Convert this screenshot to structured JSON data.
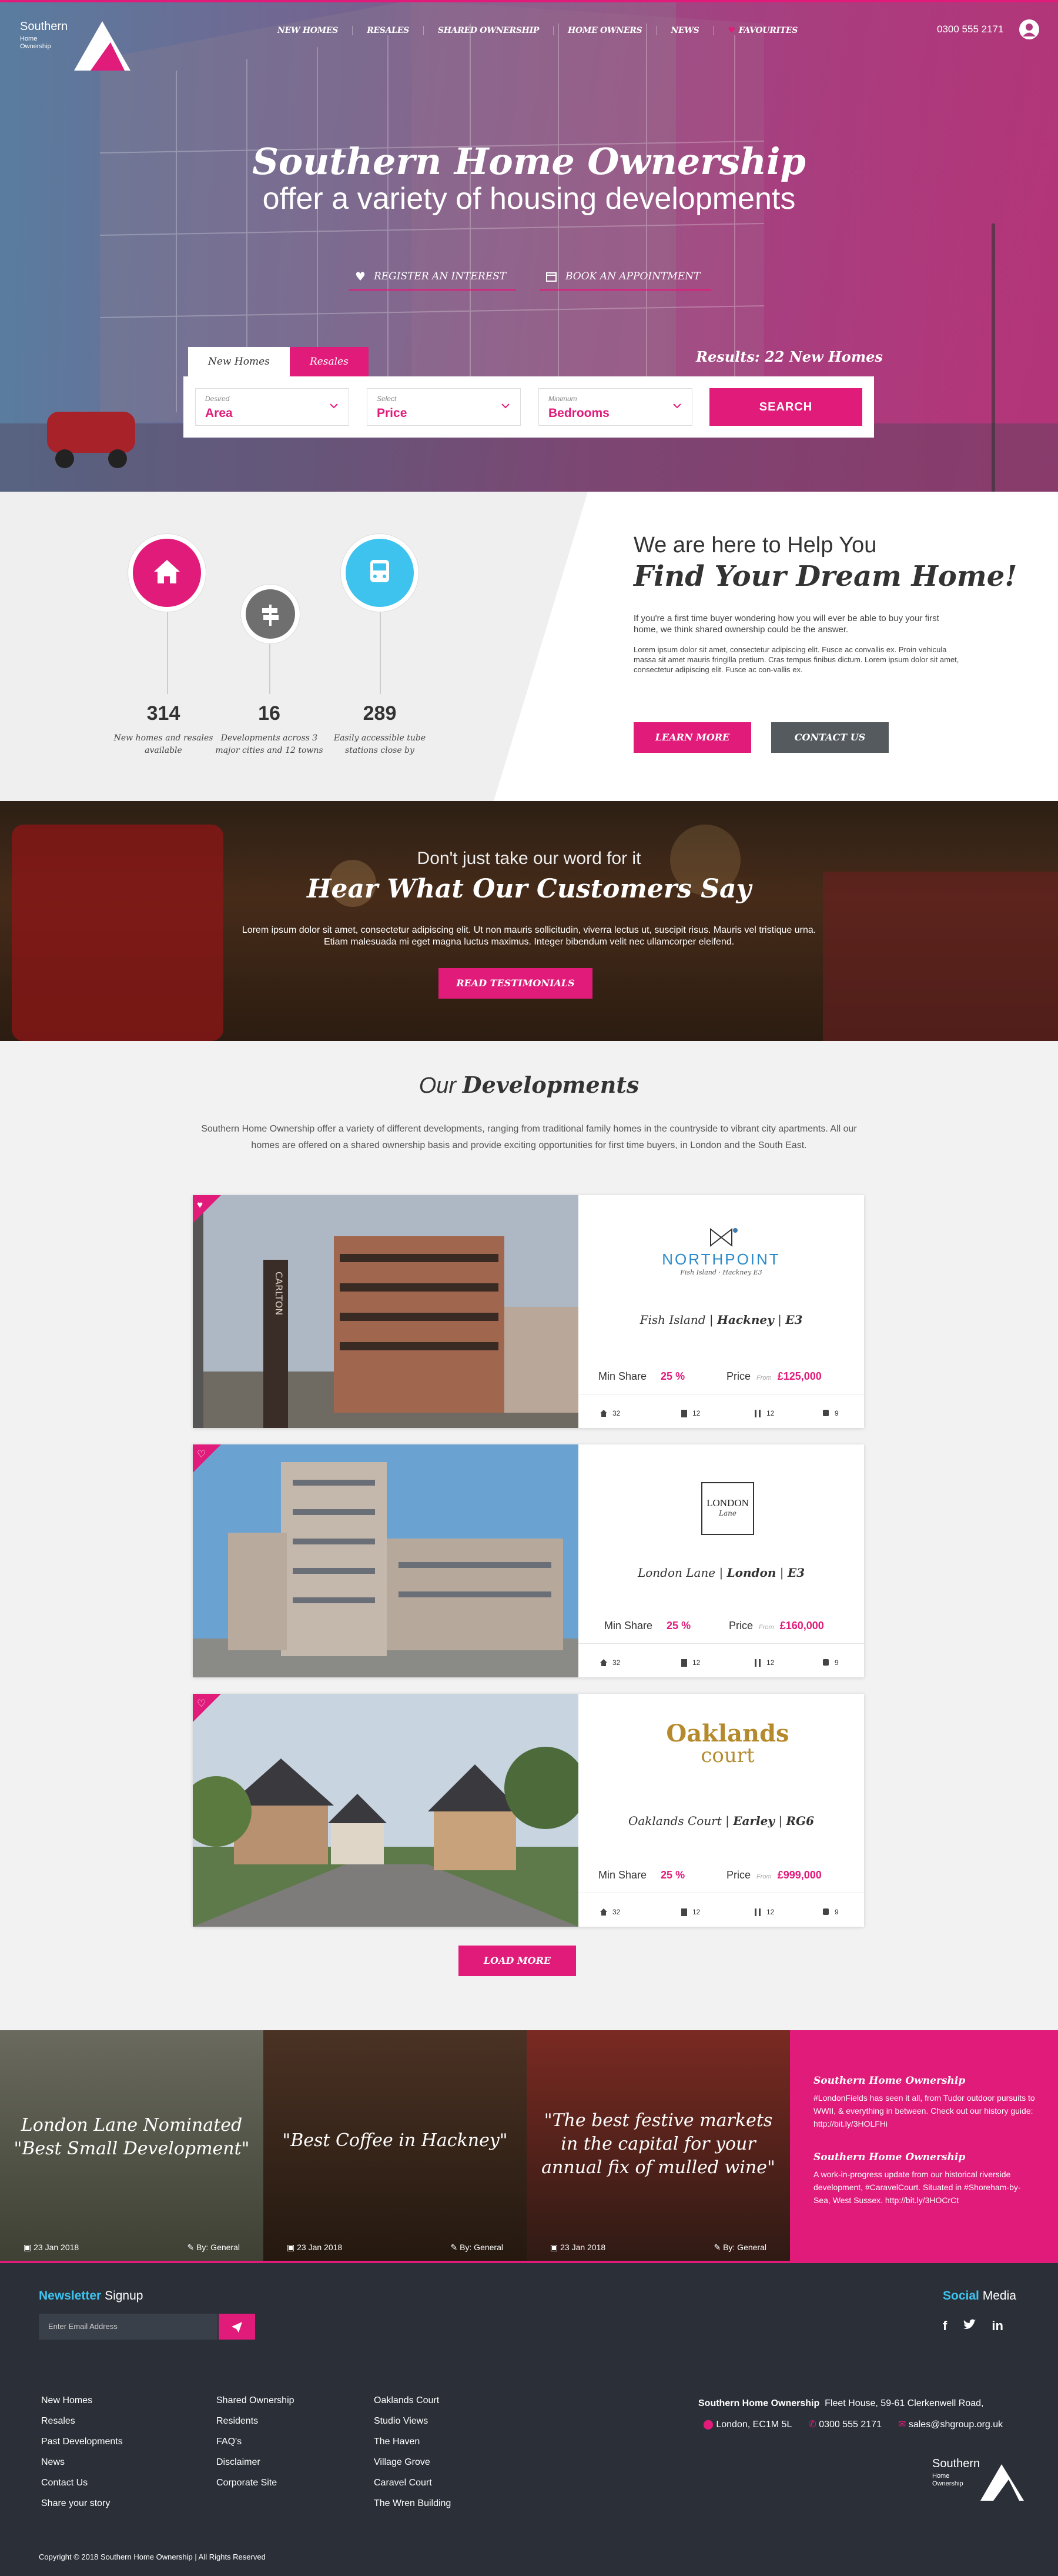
{
  "header": {
    "nav": [
      "NEW HOMES",
      "RESALES",
      "SHARED OWNERSHIP",
      "HOME OWNERS",
      "NEWS",
      "FAVOURITES"
    ],
    "phone": "0300 555 2171",
    "logo_word": "Southern",
    "logo_sub": "Home Ownership"
  },
  "hero": {
    "title": "Southern Home Ownership",
    "subtitle": "offer a variety of housing developments",
    "btn_register": "REGISTER AN INTEREST",
    "btn_appointment": "BOOK AN APPOINTMENT",
    "tab_new": "New Homes",
    "tab_resales": "Resales",
    "results": "Results: 22 New Homes",
    "filters": [
      {
        "label": "Desired",
        "value": "Area"
      },
      {
        "label": "Select",
        "value": "Price"
      },
      {
        "label": "Minimum",
        "value": "Bedrooms"
      }
    ],
    "search": "SEARCH"
  },
  "help": {
    "stats": [
      {
        "num": "314",
        "desc": "New homes and resales available"
      },
      {
        "num": "16",
        "desc": "Developments across 3 major cities and 12 towns"
      },
      {
        "num": "289",
        "desc": "Easily accessible tube stations close by"
      }
    ],
    "heading1": "We are here to Help You",
    "heading2": "Find Your Dream Home!",
    "para1": "If you're a first time buyer wondering how you will ever be able to buy your first home, we think shared ownership could be the answer.",
    "para2": "Lorem ipsum dolor sit amet, consectetur adipiscing elit. Fusce ac convallis ex. Proin vehicula massa sit amet mauris fringilla pretium. Cras tempus finibus dictum. Lorem ipsum dolor sit amet, consectetur adipiscing elit. Fusce ac con-vallis ex.",
    "learn": "LEARN MORE",
    "contact": "CONTACT US"
  },
  "testimonials": {
    "line1": "Don't just take our word for it",
    "line2": "Hear What Our Customers Say",
    "text": "Lorem ipsum dolor sit amet, consectetur adipiscing elit. Ut non mauris sollicitudin, viverra lectus ut, suscipit risus. Mauris vel tristique urna. Etiam malesuada mi eget magna luctus maximus. Integer bibendum velit nec ullamcorper eleifend.",
    "button": "READ TESTIMONIALS"
  },
  "developments": {
    "title_a": "Our",
    "title_b": "Developments",
    "intro": "Southern Home Ownership offer a variety of different developments, ranging from traditional family homes in the countryside to vibrant city apartments. All our homes are offered on a shared ownership basis and provide exciting opportunities for first time buyers, in London and the South East.",
    "min_share_label": "Min Share",
    "price_label": "Price",
    "from": "From",
    "load_more": "LOAD MORE",
    "items": [
      {
        "logo": "NORTHPOINT",
        "logo_sub": "Fish Island · Hackney E3",
        "loc_a": "Fish Island",
        "loc_b": "Hackney",
        "loc_c": "E3",
        "share": "25 %",
        "price": "£125,000",
        "icons": [
          "32",
          "12",
          "12",
          "9"
        ],
        "photo_text": "CARLTON"
      },
      {
        "logo": "LONDON",
        "logo_sub": "Lane",
        "loc_a": "London Lane",
        "loc_b": "London",
        "loc_c": "E3",
        "share": "25 %",
        "price": "£160,000",
        "icons": [
          "32",
          "12",
          "12",
          "9"
        ]
      },
      {
        "logo": "Oaklands",
        "logo_sub": "court",
        "loc_a": "Oaklands Court",
        "loc_b": "Earley",
        "loc_c": "RG6",
        "share": "25 %",
        "price": "£999,000",
        "icons": [
          "32",
          "12",
          "12",
          "9"
        ]
      }
    ]
  },
  "news": {
    "tiles": [
      {
        "quote": "London Lane Nominated \"Best Small Development\"",
        "date": "23 Jan 2018",
        "by": "By: General"
      },
      {
        "quote": "\"Best Coffee in Hackney\"",
        "date": "23 Jan 2018",
        "by": "By: General"
      },
      {
        "quote": "\"The best festive markets in the capital for your annual fix of mulled wine\"",
        "date": "23 Jan 2018",
        "by": "By: General"
      }
    ],
    "tweets": [
      {
        "title": "Southern Home Ownership",
        "text": "#LondonFields has seen it all, from Tudor outdoor pursuits to WWII, & everything in between. Check out our history guide: http://bit.ly/3HOLFHi"
      },
      {
        "title": "Southern Home Ownership",
        "text": "A work-in-progress update from our historical riverside development, #CaravelCourt. Situated in #Shoreham-by-Sea, West Sussex. http://bit.ly/3HOCrCt"
      }
    ]
  },
  "footer": {
    "newsletter_a": "Newsletter",
    "newsletter_b": "Signup",
    "email_placeholder": "Enter Email Address",
    "social_a": "Social",
    "social_b": "Media",
    "col1": [
      "New Homes",
      "Resales",
      "Past Developments",
      "News",
      "Contact Us",
      "Share your story"
    ],
    "col2": [
      "Shared Ownership",
      "Residents",
      "FAQ's",
      "Disclaimer",
      "Corporate Site"
    ],
    "col3": [
      "Oaklands Court",
      "Studio Views",
      "The Haven",
      "Village Grove",
      "Caravel Court",
      "The Wren Building"
    ],
    "company": "Southern Home Ownership",
    "address": "Fleet House,  59-61 Clerkenwell Road,",
    "city": "London, EC1M 5L",
    "tel": "0300 555 2171",
    "email": "sales@shgroup.org.uk",
    "copyright": "Copyright © 2018 Southern Home Ownership | All Rights Reserved"
  }
}
